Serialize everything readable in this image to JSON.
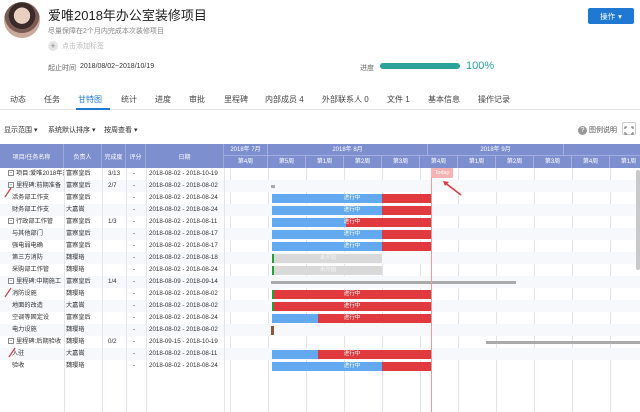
{
  "project": {
    "title": "爱唯2018年办公室装修项目",
    "subtitle": "尽量保障在2个月内完成本次装修项目",
    "add_tag": "点击添加标签",
    "dates_label": "起止时间",
    "dates": "2018/08/02~2018/10/19",
    "progress_label": "进度",
    "progress_value": "100%",
    "progress_fraction": 1.0,
    "action_button": "操作"
  },
  "tabs": [
    {
      "label": "动态"
    },
    {
      "label": "任务"
    },
    {
      "label": "甘特图"
    },
    {
      "label": "统计"
    },
    {
      "label": "进度"
    },
    {
      "label": "审批"
    },
    {
      "label": "里程碑"
    },
    {
      "label": "内部成员 4"
    },
    {
      "label": "外部联系人 0"
    },
    {
      "label": "文件 1"
    },
    {
      "label": "基本信息"
    },
    {
      "label": "操作记录"
    }
  ],
  "toolbar": {
    "display_range": "显示范围",
    "sort": "系统默认排序",
    "view": "按周查看",
    "legend_help": "图例说明"
  },
  "table": {
    "headers": [
      "项目/任务名称",
      "负责人",
      "完成度",
      "评分",
      "日期"
    ],
    "rows": [
      {
        "name": "项目:爱唯2018年办",
        "owner": "富察皇后",
        "pct": "3/13",
        "score": "-",
        "date": "2018-08-02 - 2018-10-19",
        "toggle": "−"
      },
      {
        "name": "里程碑:前期准备",
        "owner": "富察皇后",
        "pct": "2/7",
        "score": "-",
        "date": "2018-08-02 - 2018-08-02",
        "toggle": "−"
      },
      {
        "name": "活务部工作支",
        "owner": "富察皇后",
        "pct": "",
        "score": "-",
        "date": "2018-08-02 - 2018-08-24",
        "toggle": ""
      },
      {
        "name": "财务部工作支",
        "owner": "大嘉嵩",
        "pct": "",
        "score": "-",
        "date": "2018-08-02 - 2018-08-24",
        "toggle": ""
      },
      {
        "name": "行政部工作管",
        "owner": "富察皇后",
        "pct": "1/3",
        "score": "-",
        "date": "2018-08-02 - 2018-08-11",
        "toggle": "−"
      },
      {
        "name": "与其他部门",
        "owner": "富察皇后",
        "pct": "",
        "score": "-",
        "date": "2018-08-02 - 2018-08-17",
        "toggle": ""
      },
      {
        "name": "强电弱电确",
        "owner": "富察皇后",
        "pct": "",
        "score": "-",
        "date": "2018-08-02 - 2018-08-17",
        "toggle": ""
      },
      {
        "name": "第三方消防",
        "owner": "魏璎珞",
        "pct": "",
        "score": "-",
        "date": "2018-08-02 - 2018-08-18",
        "toggle": ""
      },
      {
        "name": "采购部工作管",
        "owner": "魏璎珞",
        "pct": "",
        "score": "-",
        "date": "2018-08-02 - 2018-08-24",
        "toggle": ""
      },
      {
        "name": "里程碑:中期施工",
        "owner": "富察皇后",
        "pct": "1/4",
        "score": "-",
        "date": "2018-08-09 - 2018-09-14",
        "toggle": "−"
      },
      {
        "name": "消防设施",
        "owner": "魏璎珞",
        "pct": "",
        "score": "-",
        "date": "2018-08-02 - 2018-08-02",
        "toggle": ""
      },
      {
        "name": "地面的改造",
        "owner": "大嘉嵩",
        "pct": "",
        "score": "-",
        "date": "2018-08-02 - 2018-08-02",
        "toggle": ""
      },
      {
        "name": "空调等固定设",
        "owner": "富察皇后",
        "pct": "",
        "score": "-",
        "date": "2018-08-02 - 2018-08-24",
        "toggle": ""
      },
      {
        "name": "电力设施",
        "owner": "魏璎珞",
        "pct": "",
        "score": "-",
        "date": "2018-08-02 - 2018-08-02",
        "toggle": ""
      },
      {
        "name": "里程碑:后期验收",
        "owner": "魏璎珞",
        "pct": "0/2",
        "score": "-",
        "date": "2018-09-15 - 2018-10-19",
        "toggle": "−"
      },
      {
        "name": "入驻",
        "owner": "大嘉嵩",
        "pct": "",
        "score": "-",
        "date": "2018-08-02 - 2018-08-11",
        "toggle": ""
      },
      {
        "name": "验收",
        "owner": "魏璎珞",
        "pct": "",
        "score": "-",
        "date": "2018-08-02 - 2018-08-24",
        "toggle": ""
      }
    ]
  },
  "timeline": {
    "months": [
      "2018年 7月",
      "2018年 8月",
      "2018年 9月"
    ],
    "weeks": [
      "第4周",
      "第5周",
      "第1周",
      "第2周",
      "第3周",
      "第4周",
      "第1周",
      "第2周",
      "第3周",
      "第4周",
      "第1周"
    ],
    "today_label": "Today",
    "bar_label_inprogress": "进行中",
    "bar_label_notstarted": "未开始"
  },
  "colors": {
    "header_bg": "#7d8fcf",
    "bar_blue": "#63a9ef",
    "bar_red": "#e0393e",
    "bar_gray": "#d9d9d9",
    "milestone_gray": "#aaaaaa",
    "accent": "#1f78d1",
    "progress": "#2ba39a"
  }
}
